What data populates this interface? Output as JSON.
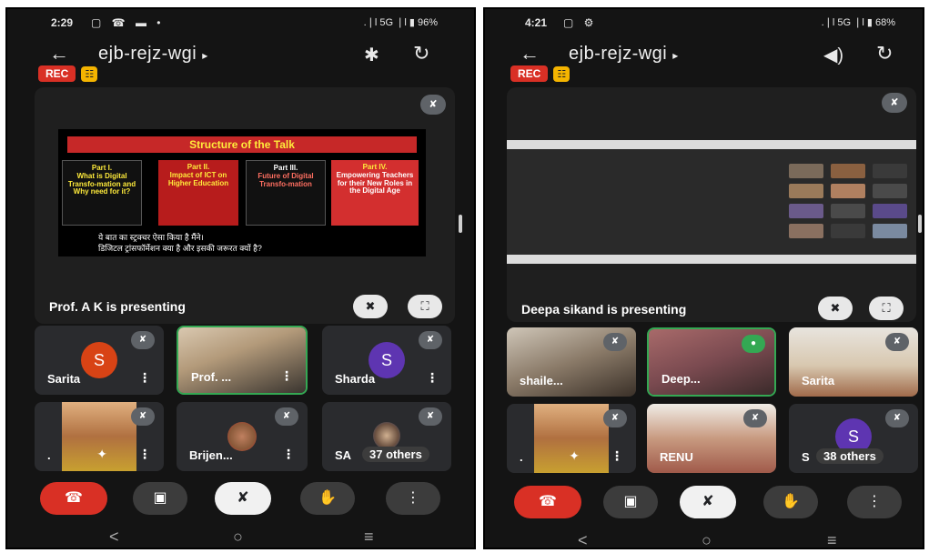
{
  "left": {
    "status": {
      "time": "2:29",
      "icons": "▢ ☎ ▬ •",
      "right": ".❘l 5G ❘l ▮ 96%"
    },
    "header": {
      "back": "←",
      "title": "ejb-rejz-wgi",
      "caret": "▸",
      "icon1": "✱",
      "icon2": "↻"
    },
    "badges": {
      "rec": "REC",
      "cap": "☷"
    },
    "presentation": {
      "label": "Prof. A K is presenting",
      "slide": {
        "title": "Structure of the Talk",
        "parts": [
          {
            "head": "Part I.",
            "body": "What is Digital Transfo-mation and Why need for it?"
          },
          {
            "head": "Part II.",
            "body": "Impact of ICT on Higher Education"
          },
          {
            "head": "Part III.",
            "body": "Future of Digital Transfo-mation"
          },
          {
            "head": "Part IV.",
            "body": "Empowering Teachers for their New Roles in the Digital Age"
          }
        ],
        "hindi_line1": "ये बात का स्ट्रक्चर ऐसा किया है मैंने।",
        "hindi_line2": "डिजिटल ट्रांसफॉर्मेशन क्या है और इसकी जरूरत क्यों है?"
      }
    },
    "tiles": [
      {
        "name": "Sarita",
        "avatar": "S",
        "color": "#d84315"
      },
      {
        "name": "Prof. ..."
      },
      {
        "name": "Sharda",
        "avatar": "S",
        "color": "#5e35b1"
      },
      {
        "name": "."
      },
      {
        "name": "Brijen..."
      },
      {
        "name": "37 others",
        "prefix": "SA"
      }
    ]
  },
  "right": {
    "status": {
      "time": "4:21",
      "icons": "▢ ⚙",
      "right": ".❘l 5G ❘l ▮ 68%"
    },
    "header": {
      "back": "←",
      "title": "ejb-rejz-wgi",
      "caret": "▸",
      "icon1": "◀)",
      "icon2": "↻"
    },
    "badges": {
      "rec": "REC",
      "cap": "☷"
    },
    "presentation": {
      "label": "Deepa sikand is presenting"
    },
    "tiles": [
      {
        "name": "shaile..."
      },
      {
        "name": "Deep..."
      },
      {
        "name": "Sarita"
      },
      {
        "name": "."
      },
      {
        "name": "RENU"
      },
      {
        "name": "38 others",
        "avatar": "S",
        "color": "#5e35b1",
        "prefix": "S"
      }
    ]
  },
  "icons": {
    "mute": "mic-off-icon",
    "pin": "pin-off-icon",
    "fullscreen": "fullscreen-icon",
    "end": "end-call-icon",
    "camera": "camera-icon",
    "mic": "mic-off-icon",
    "hand": "raise-hand-icon",
    "more": "more-vert-icon",
    "sparkle": "effects-icon"
  },
  "controls": {
    "end": "☎",
    "cam": "▣",
    "mic": "✘",
    "hand": "✋",
    "more": "⋮",
    "pin": "✖",
    "full": "⛶",
    "mute": "✘",
    "dots": "⋮",
    "sparkle": "✦"
  },
  "nav": {
    "back": "<",
    "home": "○",
    "recents": "≡"
  }
}
